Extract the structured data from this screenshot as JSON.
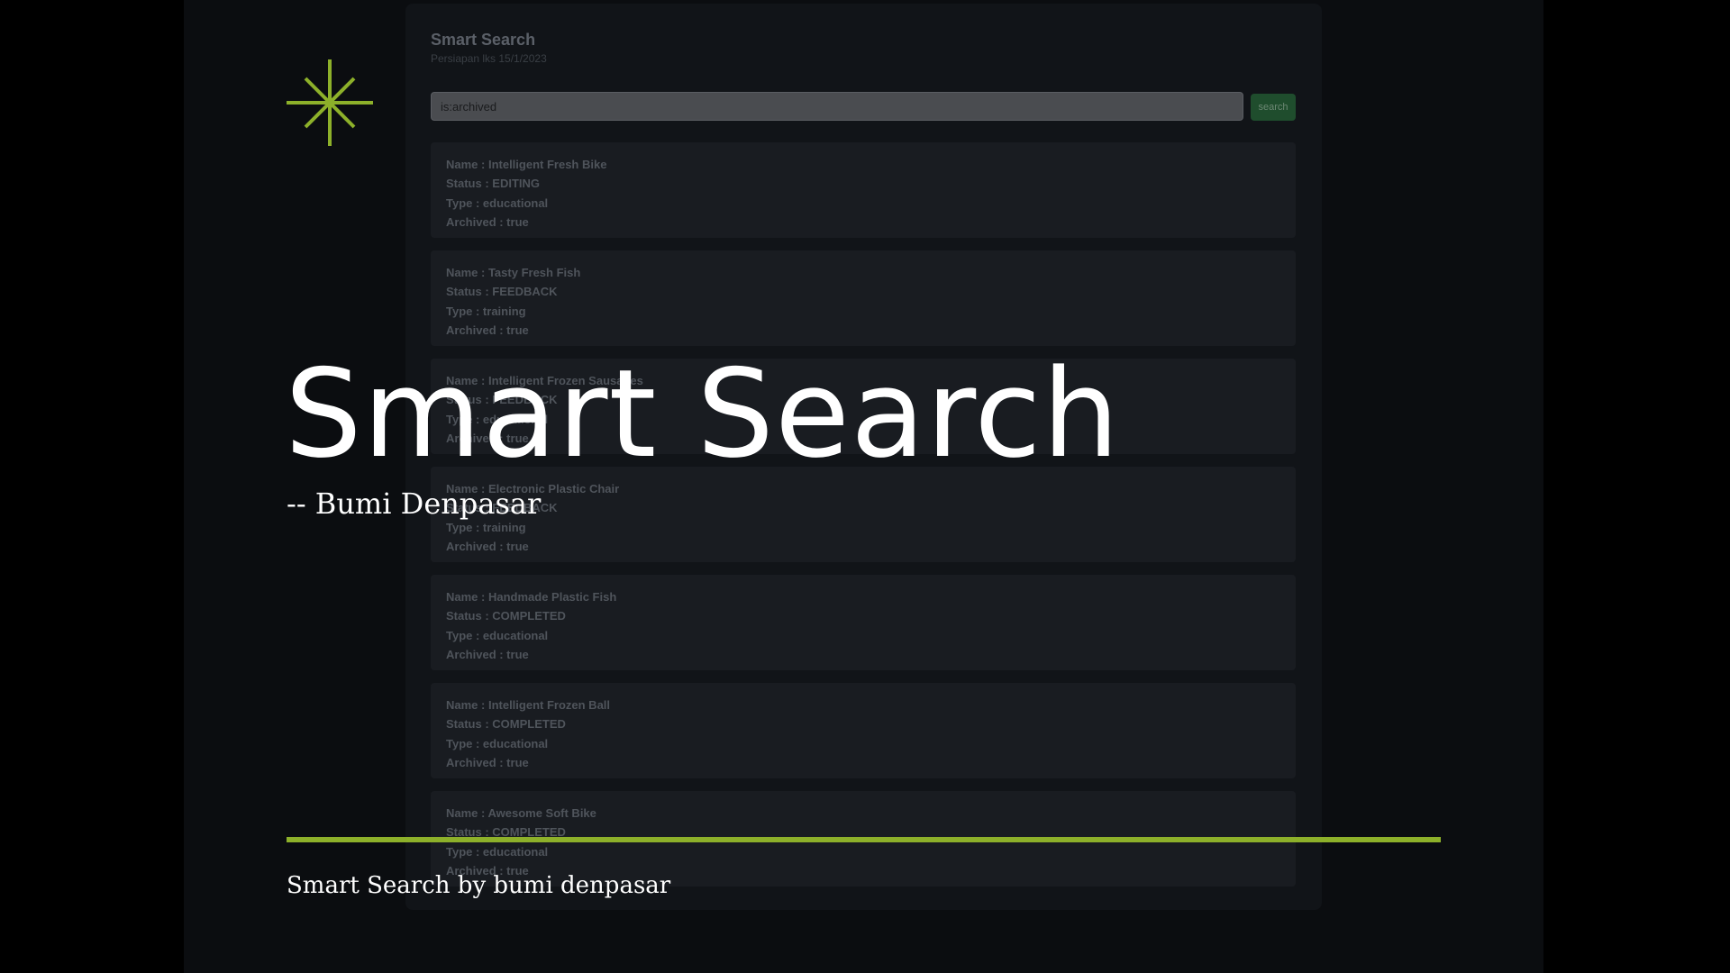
{
  "colors": {
    "accent": "#8db02a",
    "background": "#0b0d10",
    "title_text": "#ffffff"
  },
  "app": {
    "title": "Smart Search",
    "subtitle": "Persiapan lks 15/1/2023",
    "search": {
      "value": "is:archived",
      "button_label": "search"
    },
    "results": [
      {
        "name": "Name : Intelligent Fresh Bike",
        "status": "Status : EDITING",
        "type": "Type : educational",
        "archived": "Archived : true"
      },
      {
        "name": "Name : Tasty Fresh Fish",
        "status": "Status : FEEDBACK",
        "type": "Type : training",
        "archived": "Archived : true"
      },
      {
        "name": "Name : Intelligent Frozen Sausages",
        "status": "Status : FEEDBACK",
        "type": "Type : educational",
        "archived": "Archived : true"
      },
      {
        "name": "Name : Electronic Plastic Chair",
        "status": "Status : FEEDBACK",
        "type": "Type : training",
        "archived": "Archived : true"
      },
      {
        "name": "Name : Handmade Plastic Fish",
        "status": "Status : COMPLETED",
        "type": "Type : educational",
        "archived": "Archived : true"
      },
      {
        "name": "Name : Intelligent Frozen Ball",
        "status": "Status : COMPLETED",
        "type": "Type : educational",
        "archived": "Archived : true"
      },
      {
        "name": "Name : Awesome Soft Bike",
        "status": "Status : COMPLETED",
        "type": "Type : educational",
        "archived": "Archived : true"
      }
    ]
  },
  "slide": {
    "logo_icon": "asterisk-star-icon",
    "title": "Smart Search",
    "subtitle": "-- Bumi Denpasar",
    "footer": "Smart Search by bumi denpasar"
  }
}
